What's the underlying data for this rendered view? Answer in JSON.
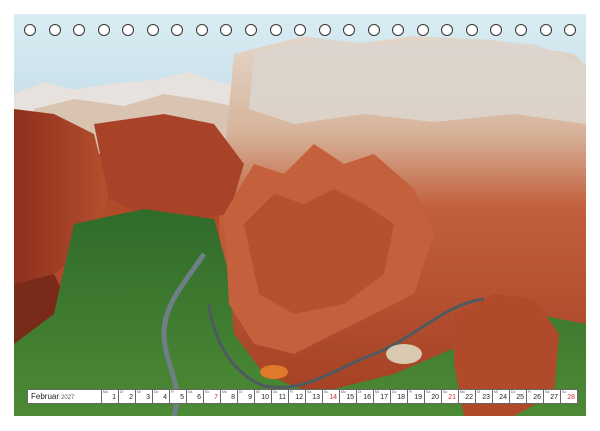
{
  "calendar": {
    "month": "Februar",
    "year": "2027",
    "days": [
      {
        "day": "1",
        "weekday": "Mo",
        "sunday": false
      },
      {
        "day": "2",
        "weekday": "Di",
        "sunday": false
      },
      {
        "day": "3",
        "weekday": "Mi",
        "sunday": false
      },
      {
        "day": "4",
        "weekday": "Do",
        "sunday": false
      },
      {
        "day": "5",
        "weekday": "Fr",
        "sunday": false
      },
      {
        "day": "6",
        "weekday": "Sa",
        "sunday": false
      },
      {
        "day": "7",
        "weekday": "So",
        "sunday": true
      },
      {
        "day": "8",
        "weekday": "Mo",
        "sunday": false
      },
      {
        "day": "9",
        "weekday": "Di",
        "sunday": false
      },
      {
        "day": "10",
        "weekday": "Mi",
        "sunday": false
      },
      {
        "day": "11",
        "weekday": "Do",
        "sunday": false
      },
      {
        "day": "12",
        "weekday": "Fr",
        "sunday": false
      },
      {
        "day": "13",
        "weekday": "Sa",
        "sunday": false
      },
      {
        "day": "14",
        "weekday": "So",
        "sunday": true
      },
      {
        "day": "15",
        "weekday": "Mo",
        "sunday": false
      },
      {
        "day": "16",
        "weekday": "Di",
        "sunday": false
      },
      {
        "day": "17",
        "weekday": "Mi",
        "sunday": false
      },
      {
        "day": "18",
        "weekday": "Do",
        "sunday": false
      },
      {
        "day": "19",
        "weekday": "Fr",
        "sunday": false
      },
      {
        "day": "20",
        "weekday": "Sa",
        "sunday": false
      },
      {
        "day": "21",
        "weekday": "So",
        "sunday": true
      },
      {
        "day": "22",
        "weekday": "Mo",
        "sunday": false
      },
      {
        "day": "23",
        "weekday": "Di",
        "sunday": false
      },
      {
        "day": "24",
        "weekday": "Mi",
        "sunday": false
      },
      {
        "day": "25",
        "weekday": "Do",
        "sunday": false
      },
      {
        "day": "26",
        "weekday": "Fr",
        "sunday": false
      },
      {
        "day": "27",
        "weekday": "Sa",
        "sunday": false
      },
      {
        "day": "28",
        "weekday": "So",
        "sunday": true
      }
    ],
    "sunday_color": "#c8302c"
  },
  "binding": {
    "hole_count": 23
  },
  "photo": {
    "subject": "canyon-landscape",
    "colors": {
      "sky": "#cfe3ee",
      "rock": "#b44a2b",
      "vegetation": "#3f7a2c",
      "river": "#6f7f86"
    }
  }
}
